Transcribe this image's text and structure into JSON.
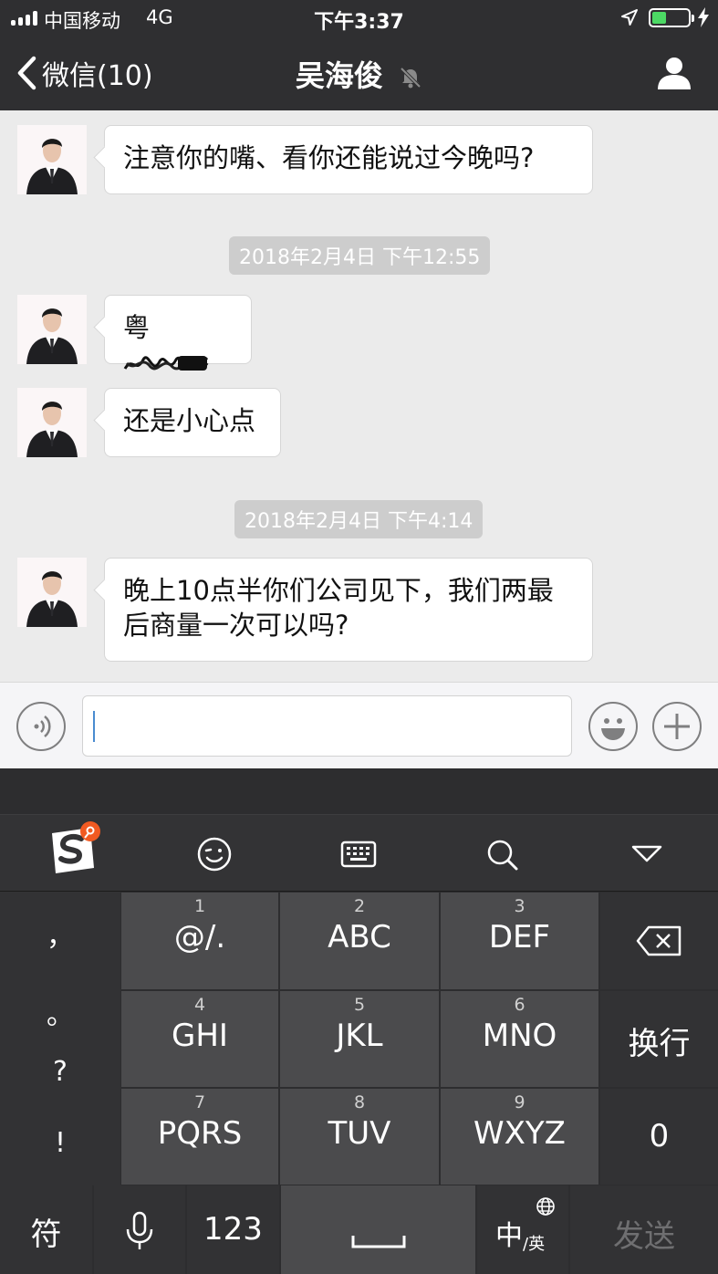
{
  "status_bar": {
    "carrier": "中国移动",
    "network": "4G",
    "time": "下午3:37",
    "battery_level": 0.3
  },
  "nav": {
    "back_label": "微信(10)",
    "title": "吴海俊",
    "icons": [
      "chevron-left-icon",
      "mute-bell-icon",
      "profile-icon"
    ]
  },
  "chat": {
    "messages": [
      {
        "type": "text",
        "text": "注意你的嘴、看你还能说过今晚吗?"
      },
      {
        "type": "timestamp",
        "text": "2018年2月4日 下午12:55"
      },
      {
        "type": "text",
        "text": "粤"
      },
      {
        "type": "text",
        "text": "还是小心点"
      },
      {
        "type": "timestamp",
        "text": "2018年2月4日 下午4:14"
      },
      {
        "type": "text",
        "lines": [
          "晚上10点半你们公司见下，我们两最",
          "后商量一次可以吗?"
        ]
      }
    ]
  },
  "input_bar": {
    "icons": [
      "voice-icon",
      "emoji-icon",
      "plus-icon"
    ],
    "value": ""
  },
  "keyboard": {
    "brand_icon": "sogou-logo-icon",
    "toolbar_icons": [
      "emoji-wink-icon",
      "keyboard-icon",
      "search-icon",
      "collapse-triangle-icon"
    ],
    "punctuation": [
      "，",
      "。",
      "?",
      "!"
    ],
    "keys": [
      {
        "num": "1",
        "label": "@/."
      },
      {
        "num": "2",
        "label": "ABC"
      },
      {
        "num": "3",
        "label": "DEF"
      },
      {
        "num": "4",
        "label": "GHI"
      },
      {
        "num": "5",
        "label": "JKL"
      },
      {
        "num": "6",
        "label": "MNO"
      },
      {
        "num": "7",
        "label": "PQRS"
      },
      {
        "num": "8",
        "label": "TUV"
      },
      {
        "num": "9",
        "label": "WXYZ"
      }
    ],
    "right_keys": {
      "delete_icon": "backspace-icon",
      "newline": "换行",
      "zero": "0"
    },
    "bottom": {
      "symbol": "符",
      "mic_icon": "mic-icon",
      "numbers": "123",
      "space_icon": "space-bar-icon",
      "lang_main": "中",
      "lang_sub": "/英",
      "globe_icon": "globe-icon",
      "send": "发送"
    }
  }
}
